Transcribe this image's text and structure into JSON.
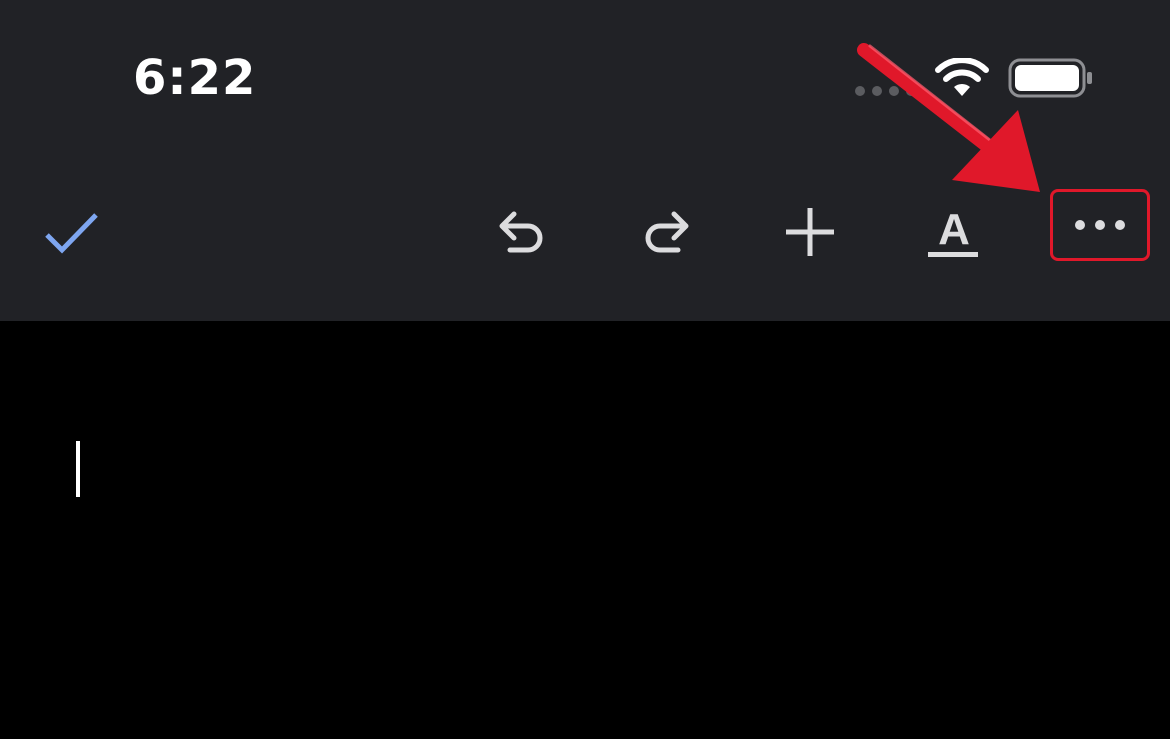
{
  "status_bar": {
    "time": "6:22",
    "signal_icon": "cellular-signal-icon",
    "wifi_icon": "wifi-icon",
    "battery_icon": "battery-icon"
  },
  "toolbar": {
    "done_icon": "checkmark-icon",
    "undo_icon": "undo-icon",
    "redo_icon": "redo-icon",
    "insert_icon": "plus-icon",
    "format_icon": "text-format-icon",
    "format_glyph": "A",
    "more_icon": "more-horizontal-icon"
  },
  "annotation": {
    "arrow_color": "#e0182a",
    "highlight_color": "#e0182a"
  },
  "colors": {
    "toolbar_background": "#212226",
    "document_background": "#000000",
    "accent_check": "#7ea6f0",
    "icon": "#dcdcde"
  }
}
